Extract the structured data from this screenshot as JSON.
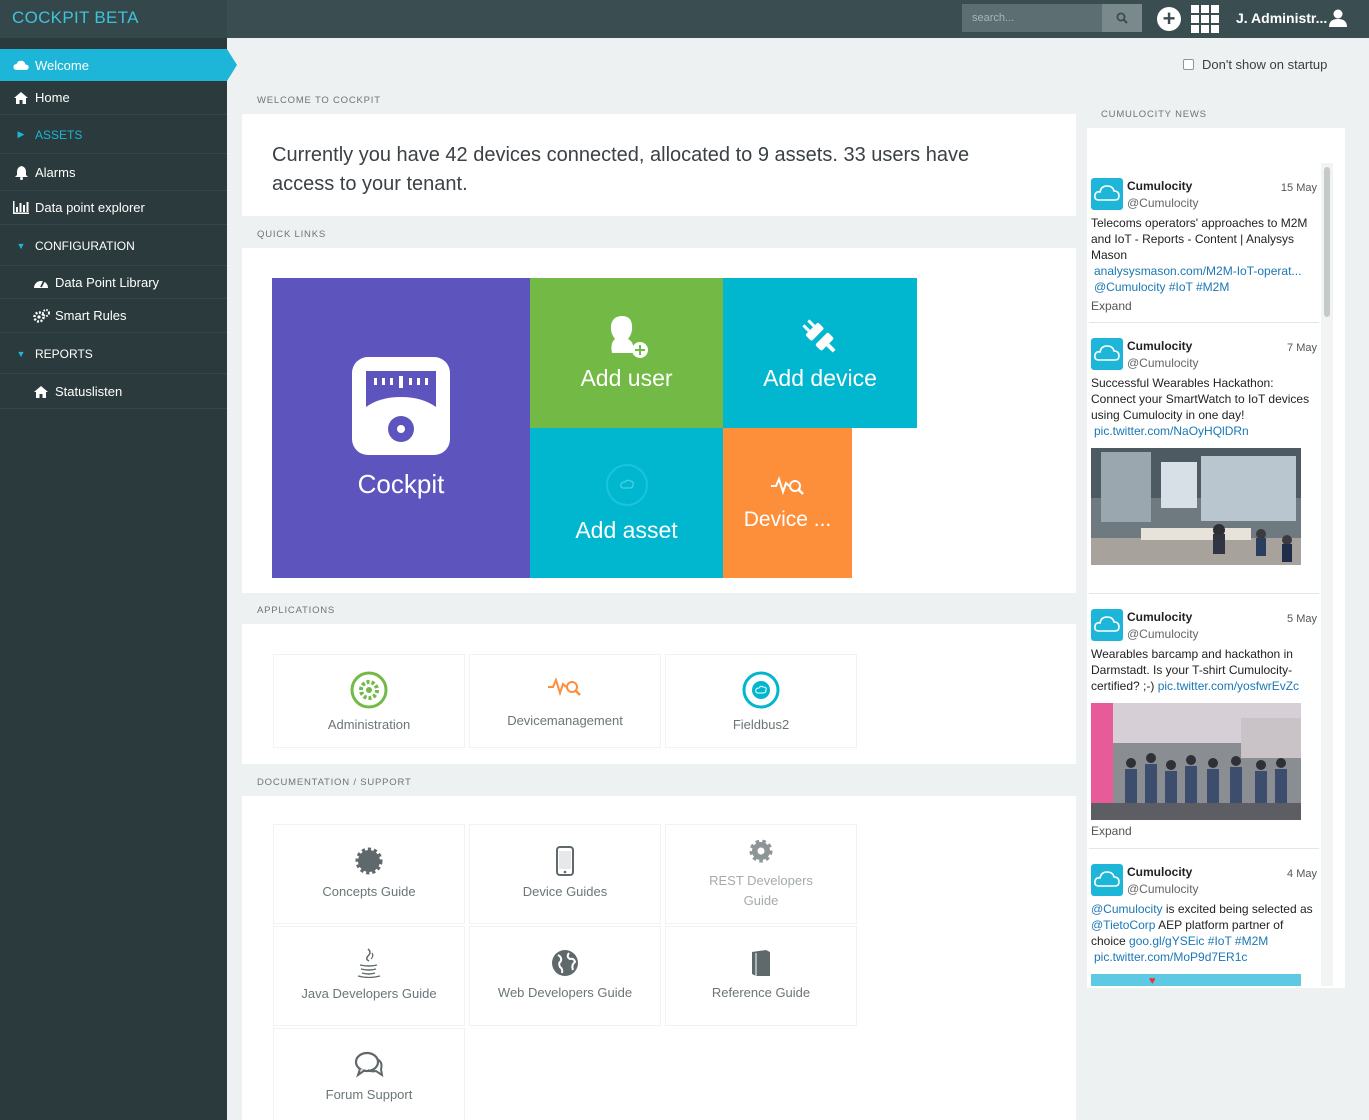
{
  "app": {
    "title": "COCKPIT BETA"
  },
  "topbar": {
    "search_placeholder": "search...",
    "user": "J. Administr..."
  },
  "sidebar": {
    "welcome": "Welcome",
    "home": "Home",
    "assets": "ASSETS",
    "alarms": "Alarms",
    "data_point_explorer": "Data point explorer",
    "configuration": "CONFIGURATION",
    "data_point_library": "Data Point Library",
    "smart_rules": "Smart Rules",
    "reports": "REPORTS",
    "statuslisten": "Statuslisten"
  },
  "header": {
    "dont_show": "Don't show on startup"
  },
  "welcome": {
    "section": "WELCOME TO COCKPIT",
    "text": "Currently you have 42 devices connected, allocated to 9 assets. 33 users have access to your tenant."
  },
  "quick_links": {
    "section": "QUICK LINKS",
    "cockpit": "Cockpit",
    "add_user": "Add user",
    "add_device": "Add device",
    "add_asset": "Add asset",
    "device": "Device ..."
  },
  "applications": {
    "section": "APPLICATIONS",
    "items": [
      "Administration",
      "Devicemanagement",
      "Fieldbus2"
    ]
  },
  "docs": {
    "section": "DOCUMENTATION / SUPPORT",
    "concepts": "Concepts Guide",
    "device": "Device Guides",
    "rest_1": "REST Developers",
    "rest_2": "Guide",
    "java": "Java Developers Guide",
    "web": "Web Developers Guide",
    "reference": "Reference Guide",
    "forum": "Forum Support"
  },
  "news": {
    "section": "CUMULOCITY NEWS",
    "expand": "Expand",
    "tweets": [
      {
        "author": "Cumulocity",
        "handle": "@Cumulocity",
        "date": "15 May",
        "text": "Telecoms operators' approaches to M2M and IoT - Reports - Content | Analysys Mason",
        "link": "analysysmason.com/M2M-IoT-operat...",
        "tags": "@Cumulocity #IoT #M2M"
      },
      {
        "author": "Cumulocity",
        "handle": "@Cumulocity",
        "date": "7 May",
        "text": "Successful Wearables Hackathon: Connect your SmartWatch to IoT devices using Cumulocity in one day!",
        "link": "pic.twitter.com/NaOyHQlDRn"
      },
      {
        "author": "Cumulocity",
        "handle": "@Cumulocity",
        "date": "5 May",
        "text": "Wearables barcamp and hackathon in Darmstadt. Is your T-shirt Cumulocity-certified? ;-)",
        "link": "pic.twitter.com/yosfwrEvZc"
      },
      {
        "author": "Cumulocity",
        "handle": "@Cumulocity",
        "date": "4 May",
        "mention": "@Cumulocity",
        "text": "is excited being selected as",
        "mention2": "@TietoCorp",
        "text2": "AEP platform partner of choice",
        "link": "goo.gl/gYSEic",
        "tags": "#IoT #M2M",
        "link2": "pic.twitter.com/MoP9d7ER1c"
      }
    ]
  }
}
